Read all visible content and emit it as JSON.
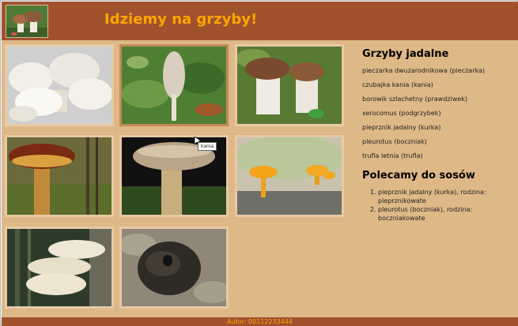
{
  "header": {
    "title": "Idziemy na grzyby!",
    "logo_icon": "mushroom-logo-icon"
  },
  "gallery": {
    "tooltip": "kania",
    "images": [
      {
        "name": "photo-pieczarka",
        "label": "pieczarka dwuzarodnikowa"
      },
      {
        "name": "photo-kania",
        "label": "czubajka kania"
      },
      {
        "name": "photo-borowik",
        "label": "borowik szlachetny"
      },
      {
        "name": "photo-podgrzybek",
        "label": "xerocomus"
      },
      {
        "name": "photo-podgrzybek-2",
        "label": "xerocomus"
      },
      {
        "name": "photo-kurka",
        "label": "pieprznik jadalny"
      },
      {
        "name": "photo-boczniak",
        "label": "pleurotus"
      },
      {
        "name": "photo-trufla",
        "label": "trufla letnia"
      }
    ]
  },
  "aside": {
    "heading1": "Grzyby jadalne",
    "items": [
      "pieczarka dwuzarodnikowa (pieczarka)",
      "czubajka kania (kania)",
      "borowik szlachetny (prawdziwek)",
      "xerocomus (podgrzybek)",
      "pieprznik jadalny (kurka)",
      "pleurotus (boczniak)",
      "trufla letnia (trufla)"
    ],
    "heading2": "Polecamy do sosów",
    "recommended": [
      "pieprznik jadalny (kurka), rodzina: pieprznikowate",
      "pleurotus (boczniak), rodzina: boczniakowate"
    ]
  },
  "footer": {
    "text": "Autor: 00112233444"
  },
  "colors": {
    "header": "#a0522d",
    "title": "#ffa500",
    "main": "#deb887"
  }
}
